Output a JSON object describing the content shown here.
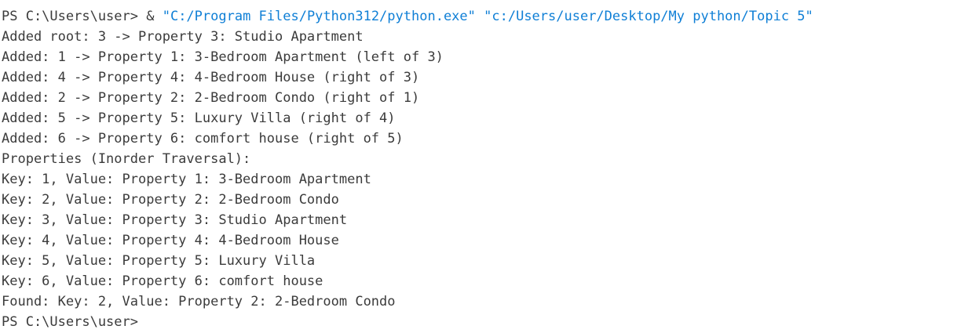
{
  "colors": {
    "background": "#ffffff",
    "text": "#3b3b3b",
    "string": "#0f7fd6"
  },
  "command": {
    "prompt": "PS C:\\Users\\user> ",
    "operator": "& ",
    "exe": "\"C:/Program Files/Python312/python.exe\"",
    "space": " ",
    "script": "\"c:/Users/user/Desktop/My python/Topic 5\""
  },
  "output": [
    "Added root: 3 -> Property 3: Studio Apartment",
    "Added: 1 -> Property 1: 3-Bedroom Apartment (left of 3)",
    "Added: 4 -> Property 4: 4-Bedroom House (right of 3)",
    "Added: 2 -> Property 2: 2-Bedroom Condo (right of 1)",
    "Added: 5 -> Property 5: Luxury Villa (right of 4)",
    "Added: 6 -> Property 6: comfort house (right of 5)",
    "Properties (Inorder Traversal):",
    "Key: 1, Value: Property 1: 3-Bedroom Apartment",
    "Key: 2, Value: Property 2: 2-Bedroom Condo",
    "Key: 3, Value: Property 3: Studio Apartment",
    "Key: 4, Value: Property 4: 4-Bedroom House",
    "Key: 5, Value: Property 5: Luxury Villa",
    "Key: 6, Value: Property 6: comfort house",
    "Found: Key: 2, Value: Property 2: 2-Bedroom Condo"
  ],
  "final_prompt": "PS C:\\Users\\user>"
}
